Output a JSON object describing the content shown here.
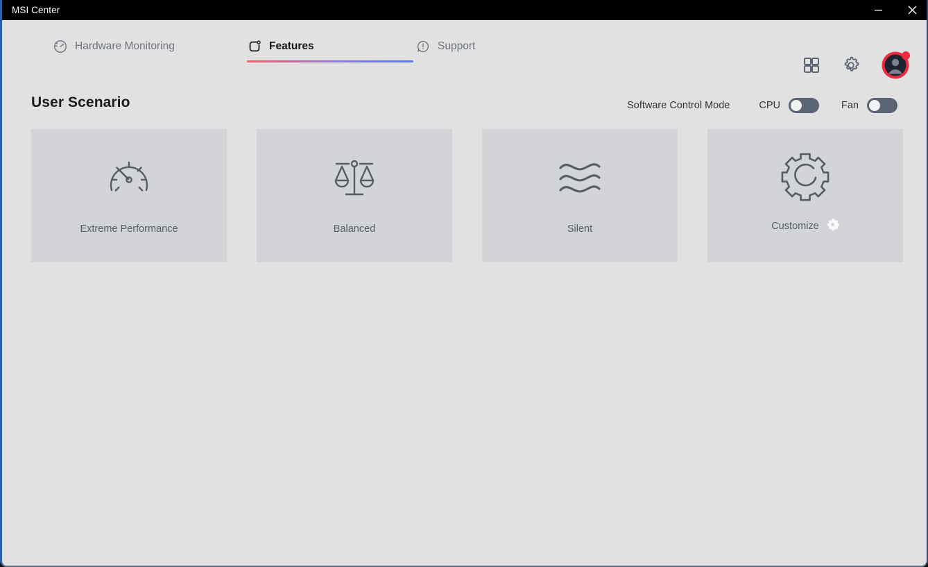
{
  "window": {
    "title": "MSI Center",
    "controls": [
      {
        "name": "minimize",
        "label": "—"
      },
      {
        "name": "close",
        "label": "✕"
      }
    ]
  },
  "nav": {
    "tabs": [
      {
        "label": "Hardware Monitoring",
        "icon": "gauge-circle-icon",
        "active": false
      },
      {
        "label": "Features",
        "icon": "features-icon",
        "active": true
      },
      {
        "label": "Support",
        "icon": "support-bubble-icon",
        "active": false
      }
    ],
    "actions": [
      {
        "name": "apps-grid-button",
        "icon": "grid-icon"
      },
      {
        "name": "settings-button",
        "icon": "gear-icon"
      },
      {
        "name": "account-button",
        "icon": "avatar-icon",
        "has_notification": true
      }
    ]
  },
  "page": {
    "title": "User Scenario"
  },
  "control_mode": {
    "label": "Software Control Mode",
    "toggles": [
      {
        "name": "CPU",
        "state": "off"
      },
      {
        "name": "Fan",
        "state": "off"
      }
    ]
  },
  "scenarios": [
    {
      "label": "Extreme Performance",
      "icon": "speedometer-icon",
      "has_settings": false
    },
    {
      "label": "Balanced",
      "icon": "balance-scale-icon",
      "has_settings": false
    },
    {
      "label": "Silent",
      "icon": "waves-icon",
      "has_settings": false
    },
    {
      "label": "Customize",
      "icon": "gear-outline-icon",
      "has_settings": true
    }
  ],
  "colors": {
    "accent_red": "#f4606a",
    "accent_blue": "#5b7ce8",
    "notification": "#ee2b3e",
    "card_bg": "#d2d4d8",
    "page_bg": "#e1e1e1",
    "toggle_track": "#5a6472",
    "icon_stroke": "#555c66"
  }
}
